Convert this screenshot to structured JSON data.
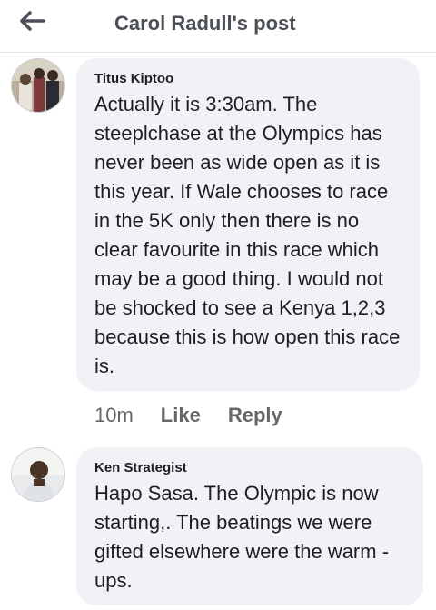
{
  "header": {
    "back_icon": "arrow-left-icon",
    "title": "Carol Radull's post"
  },
  "comments": [
    {
      "author": "Titus Kiptoo",
      "text": "Actually it is 3:30am. The steeplchase at the Olympics has never been as wide open as it is this year. If Wale chooses to race in the 5K only then there is no clear favourite in this race which may be a good thing. I would not be shocked to see a Kenya 1,2,3 because this is how open this race is.",
      "time": "10m",
      "like_label": "Like",
      "reply_label": "Reply"
    },
    {
      "author": "Ken Strategist",
      "text": "Hapo Sasa. The Olympic is now starting,. The beatings we were gifted elsewhere were the warm -ups."
    }
  ],
  "colors": {
    "bubble": "#f0f2f5",
    "header_text": "#4b4f56",
    "action_text": "#65676b"
  }
}
